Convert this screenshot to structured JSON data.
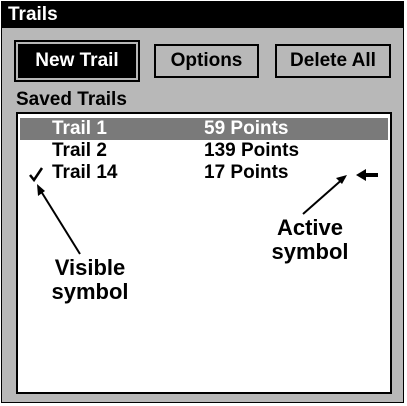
{
  "window": {
    "title": "Trails"
  },
  "toolbar": {
    "new_trail_label": "New Trail",
    "options_label": "Options",
    "delete_all_label": "Delete All"
  },
  "list": {
    "heading": "Saved Trails",
    "rows": [
      {
        "name": "Trail 1",
        "points": "59 Points",
        "selected": true,
        "visible_check": false
      },
      {
        "name": "Trail 2",
        "points": "139 Points",
        "selected": false,
        "visible_check": false
      },
      {
        "name": "Trail 14",
        "points": "17 Points",
        "selected": false,
        "visible_check": true
      }
    ]
  },
  "annotations": {
    "active_symbol": "Active symbol",
    "visible_symbol": "Visible symbol"
  },
  "icons": {
    "visible": "checkmark-icon",
    "active": "left-arrow-icon"
  },
  "colors": {
    "background": "#b8b8b8",
    "selected_row": "#7a7a7a",
    "titlebar": "#000000"
  }
}
